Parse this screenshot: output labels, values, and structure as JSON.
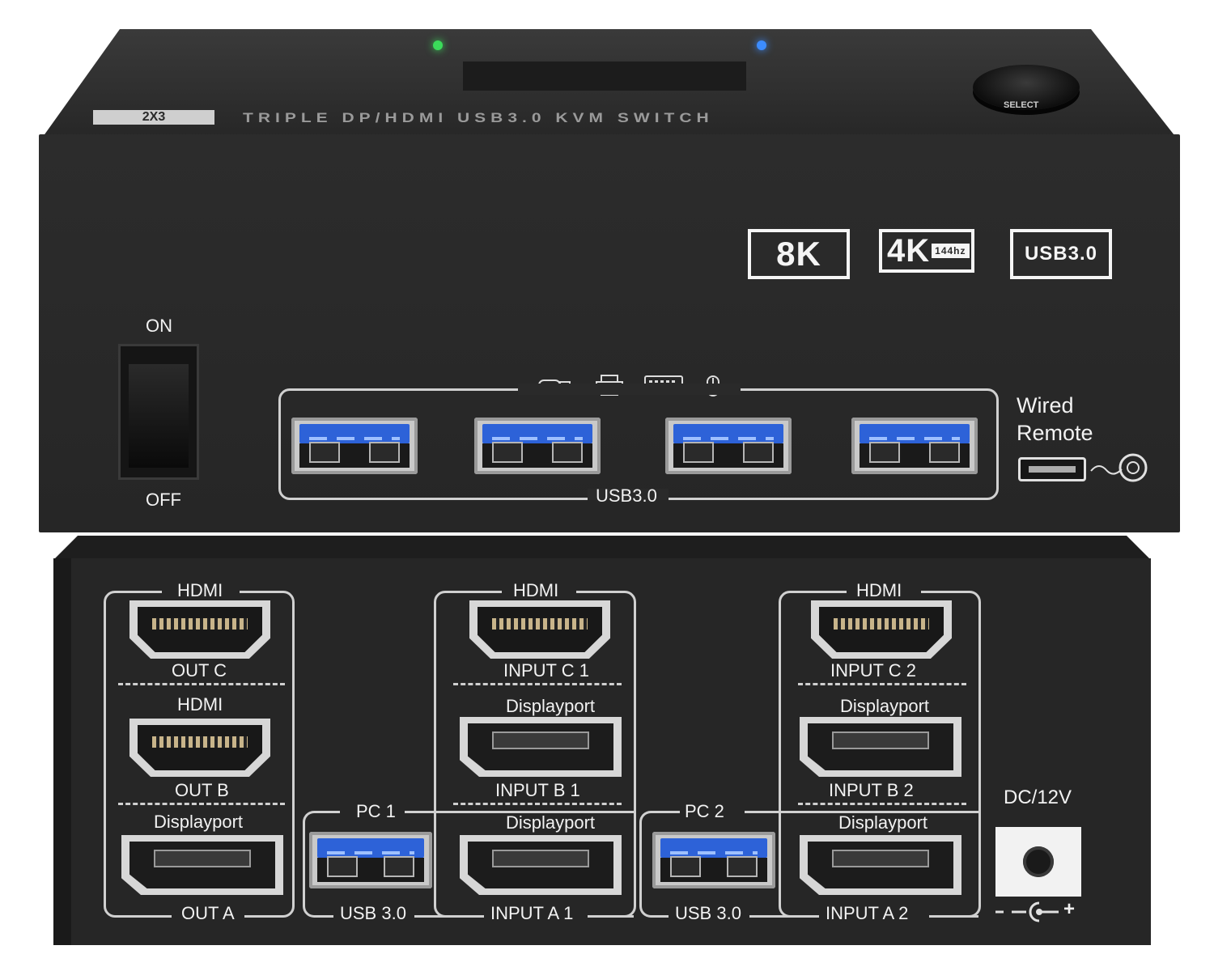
{
  "top_panel": {
    "model_badge": "2X3",
    "title": "TRIPLE DP/HDMI USB3.0 KVM SWITCH",
    "select_label": "SELECT",
    "badges": [
      "8K",
      "4K",
      "144hz",
      "USB3.0"
    ],
    "power_on": "ON",
    "power_off": "OFF",
    "usb_group_label": "USB3.0",
    "remote_label_line1": "Wired",
    "remote_label_line2": "Remote",
    "led_colors": [
      "#3bdc5a",
      "#3c8cff"
    ]
  },
  "bottom_panel": {
    "out_group": {
      "hdmi_c_label": "HDMI",
      "out_c": "OUT C",
      "hdmi_b_label": "HDMI",
      "out_b": "OUT B",
      "dp_label": "Displayport",
      "out_a": "OUT A"
    },
    "pc1": {
      "label": "PC 1",
      "hdmi_label": "HDMI",
      "input_c": "INPUT C 1",
      "dp_b_label": "Displayport",
      "input_b": "INPUT B 1",
      "dp_a_label": "Displayport",
      "usb": "USB 3.0",
      "input_a": "INPUT A 1"
    },
    "pc2": {
      "label": "PC 2",
      "hdmi_label": "HDMI",
      "input_c": "INPUT C 2",
      "dp_b_label": "Displayport",
      "input_b": "INPUT B 2",
      "dp_a_label": "Displayport",
      "usb": "USB 3.0",
      "input_a": "INPUT A 2"
    },
    "dc_label": "DC/12V",
    "polarity_minus": "-",
    "polarity_plus": "+"
  }
}
